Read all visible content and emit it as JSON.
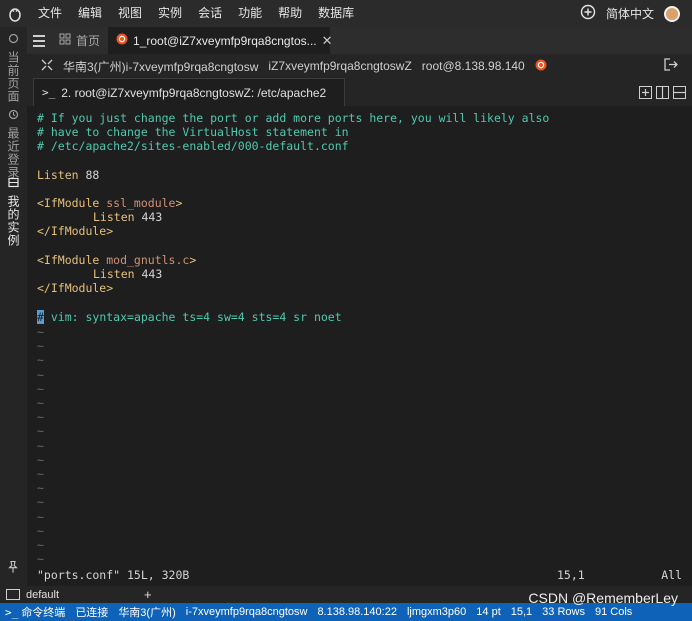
{
  "menu": {
    "items": [
      "文件",
      "编辑",
      "视图",
      "实例",
      "会话",
      "功能",
      "帮助",
      "数据库"
    ],
    "language": "简体中文"
  },
  "sidebar": {
    "tabs": [
      {
        "label": "当前页面"
      },
      {
        "label": "最近登录"
      },
      {
        "label": "我的实例"
      }
    ]
  },
  "tabs": {
    "home_label": "首页",
    "session_label": "1_root@iZ7xveymfp9rqa8cngtos..."
  },
  "session_info": {
    "region": "华南3(广州)i-7xveymfp9rqa8cngtosw",
    "hostname": "iZ7xveymfp9rqa8cngtoswZ",
    "user_host": "root@8.138.98.140"
  },
  "terminal_tab": {
    "label": "2. root@iZ7xveymfp9rqa8cngtoswZ: /etc/apache2"
  },
  "terminal": {
    "comment_1": "# If you just change the port or add more ports here, you will likely also",
    "comment_2": "# have to change the VirtualHost statement in",
    "comment_3": "# /etc/apache2/sites-enabled/000-default.conf",
    "listen_keyword": "Listen",
    "listen_port": " 88",
    "ifmodule_1_open": "<IfModule",
    "ifmodule_1_name": " ssl_module",
    "ifmodule_1_close_bracket": ">",
    "listen_ssl_keyword": "Listen",
    "listen_ssl_port": " 443",
    "ifmodule_close": "</IfModule>",
    "ifmodule_2_open": "<IfModule",
    "ifmodule_2_name": " mod_gnutls.c",
    "ifmodule_2_close_bracket": ">",
    "listen_gnutls_keyword": "Listen",
    "listen_gnutls_port": " 443",
    "ifmodule_close_2": "</IfModule>",
    "vim_cursor_char": "#",
    "vim_modeline": " vim: syntax=apache ts=4 sw=4 sts=4 sr noet",
    "tilde": "~",
    "status_file": "\"ports.conf\" 15L, 320B",
    "status_pos": "15,1",
    "status_all": "All"
  },
  "defaultbar": {
    "label": "default",
    "plus": "+"
  },
  "statusbar": {
    "items": [
      "命令终端",
      "已连接",
      "华南3(广州)",
      "i-7xveymfp9rqa8cngtosw",
      "8.138.98.140:22",
      "ljmgxm3p60",
      "14 pt",
      "15,1",
      "33 Rows",
      "91 Cols"
    ]
  },
  "watermark": "CSDN @RememberLey",
  "colors": {
    "statusbar": "#0e63b8",
    "comment": "#4ec9b0",
    "keyword": "#e5c07b",
    "ubuntu": "#e95420"
  }
}
